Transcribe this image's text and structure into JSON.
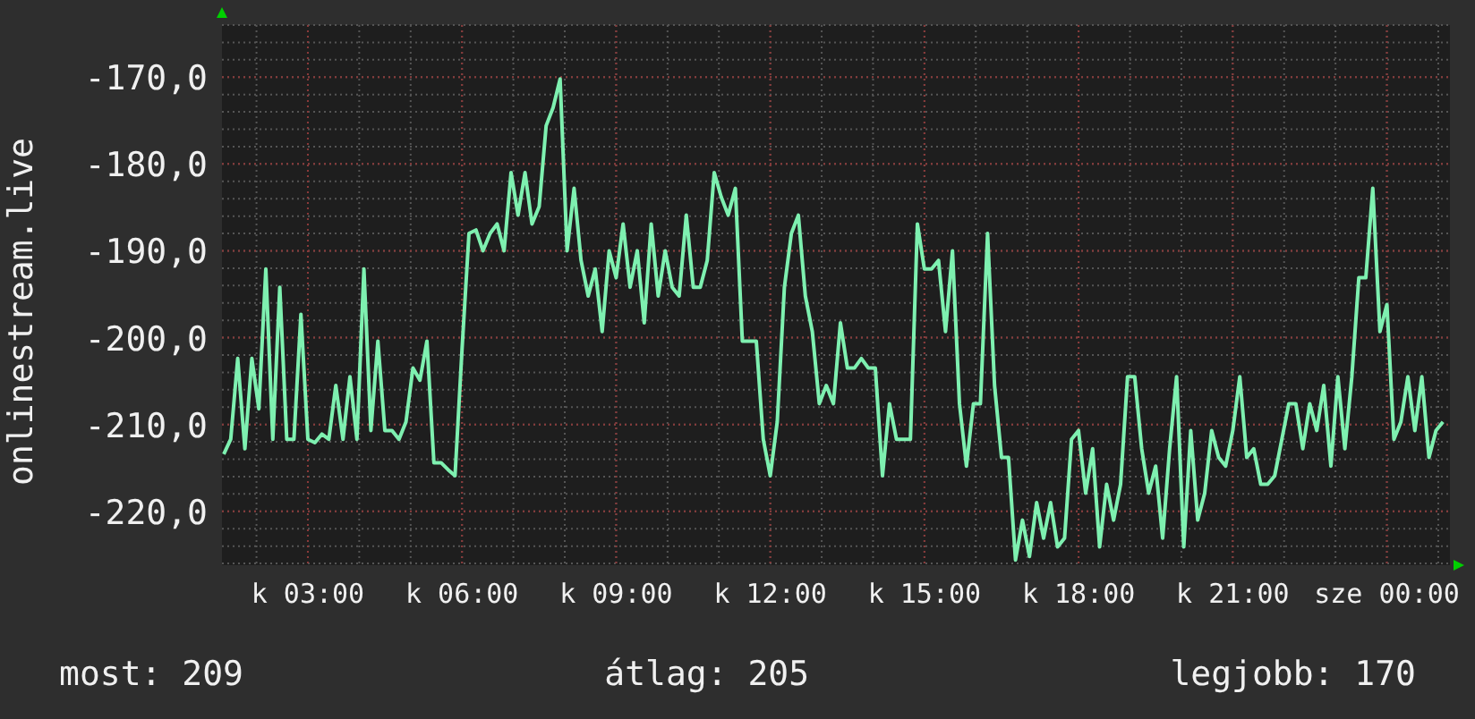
{
  "chart": {
    "chart_data": {
      "type": "line",
      "ylabel": "onlinestream.live",
      "grid": true,
      "categories": [
        null,
        null,
        null,
        null,
        null,
        null,
        null,
        null,
        null,
        null,
        null,
        null,
        "k 03:00",
        null,
        null,
        null,
        null,
        null,
        null,
        null,
        null,
        null,
        null,
        null,
        null,
        null,
        null,
        null,
        null,
        null,
        null,
        null,
        null,
        null,
        "k 06:00",
        null,
        null,
        null,
        null,
        null,
        null,
        null,
        null,
        null,
        null,
        null,
        null,
        null,
        null,
        null,
        null,
        null,
        null,
        null,
        null,
        null,
        "k 09:00",
        null,
        null,
        null,
        null,
        null,
        null,
        null,
        null,
        null,
        null,
        null,
        null,
        null,
        null,
        null,
        null,
        null,
        null,
        null,
        null,
        null,
        "k 12:00",
        null,
        null,
        null,
        null,
        null,
        null,
        null,
        null,
        null,
        null,
        null,
        null,
        null,
        null,
        null,
        null,
        null,
        null,
        null,
        null,
        null,
        "k 15:00",
        null,
        null,
        null,
        null,
        null,
        null,
        null,
        null,
        null,
        null,
        null,
        null,
        null,
        null,
        null,
        null,
        null,
        null,
        null,
        null,
        null,
        "k 18:00",
        null,
        null,
        null,
        null,
        null,
        null,
        null,
        null,
        null,
        null,
        null,
        null,
        null,
        null,
        null,
        null,
        null,
        null,
        null,
        null,
        null,
        "k 21:00",
        null,
        null,
        null,
        null,
        null,
        null,
        null,
        null,
        null,
        null,
        null,
        null,
        null,
        null,
        null,
        null,
        null,
        null,
        null,
        null,
        null,
        "sze 00:00",
        null,
        null,
        null,
        null,
        null,
        null,
        null,
        null
      ],
      "ylim": [
        -226.2,
        -164
      ],
      "yticks": [
        {
          "value": -170,
          "label": "-170,0"
        },
        {
          "value": -180,
          "label": "-180,0"
        },
        {
          "value": -190,
          "label": "-190,0"
        },
        {
          "value": -200,
          "label": "-200,0"
        },
        {
          "value": -210,
          "label": "-210,0"
        },
        {
          "value": -220,
          "label": "-220,0"
        }
      ],
      "series": [
        {
          "color": "#7ef0b0",
          "values": [
            -213.4,
            -211.7,
            -202.4,
            -212.8,
            -202.4,
            -208.2,
            -192.1,
            -211.7,
            -194.2,
            -211.7,
            -211.7,
            -197.3,
            -211.7,
            -212.1,
            -211.1,
            -211.7,
            -205.5,
            -211.7,
            -204.5,
            -211.7,
            -192.1,
            -210.7,
            -200.4,
            -210.7,
            -210.7,
            -211.7,
            -209.7,
            -203.5,
            -204.9,
            -200.4,
            -214.4,
            -214.4,
            -215.2,
            -215.9,
            -201.4,
            -188.0,
            -187.6,
            -190.0,
            -188.0,
            -186.9,
            -190.0,
            -181.0,
            -185.9,
            -181.0,
            -186.9,
            -184.9,
            -175.6,
            -173.5,
            -170.2,
            -190.0,
            -182.8,
            -191.1,
            -195.2,
            -192.1,
            -199.3,
            -190.0,
            -193.1,
            -186.9,
            -194.2,
            -190.0,
            -198.3,
            -186.9,
            -195.2,
            -190.0,
            -194.2,
            -195.2,
            -185.9,
            -194.2,
            -194.2,
            -191.1,
            -181.0,
            -183.8,
            -185.9,
            -182.8,
            -200.4,
            -200.4,
            -200.4,
            -211.7,
            -215.9,
            -209.7,
            -194.2,
            -188.0,
            -185.9,
            -195.2,
            -199.3,
            -207.6,
            -205.5,
            -207.6,
            -198.3,
            -203.5,
            -203.5,
            -202.4,
            -203.5,
            -203.5,
            -215.9,
            -207.6,
            -211.7,
            -211.7,
            -211.7,
            -186.9,
            -192.1,
            -192.1,
            -191.1,
            -199.3,
            -190.0,
            -207.6,
            -214.8,
            -207.6,
            -207.6,
            -188.0,
            -205.5,
            -213.8,
            -213.8,
            -225.6,
            -221.0,
            -225.2,
            -219.0,
            -223.1,
            -219.0,
            -224.1,
            -223.1,
            -211.7,
            -210.7,
            -217.9,
            -212.8,
            -224.1,
            -216.9,
            -221.0,
            -216.9,
            -204.5,
            -204.5,
            -212.8,
            -217.9,
            -214.8,
            -223.1,
            -212.8,
            -204.5,
            -224.1,
            -210.7,
            -221.0,
            -217.9,
            -210.7,
            -213.8,
            -214.8,
            -210.7,
            -204.5,
            -213.8,
            -212.8,
            -216.9,
            -216.9,
            -215.9,
            -211.7,
            -207.6,
            -207.6,
            -212.8,
            -207.6,
            -210.7,
            -205.5,
            -214.8,
            -204.5,
            -212.8,
            -204.5,
            -193.1,
            -193.1,
            -182.8,
            -199.3,
            -196.2,
            -211.7,
            -209.7,
            -204.5,
            -210.7,
            -204.5,
            -213.8,
            -210.7,
            -209.7
          ]
        }
      ]
    }
  },
  "legend": [
    {
      "label": "most:",
      "value": "209"
    },
    {
      "label": "átlag:",
      "value": "205"
    },
    {
      "label": "legjobb:",
      "value": "170"
    }
  ]
}
